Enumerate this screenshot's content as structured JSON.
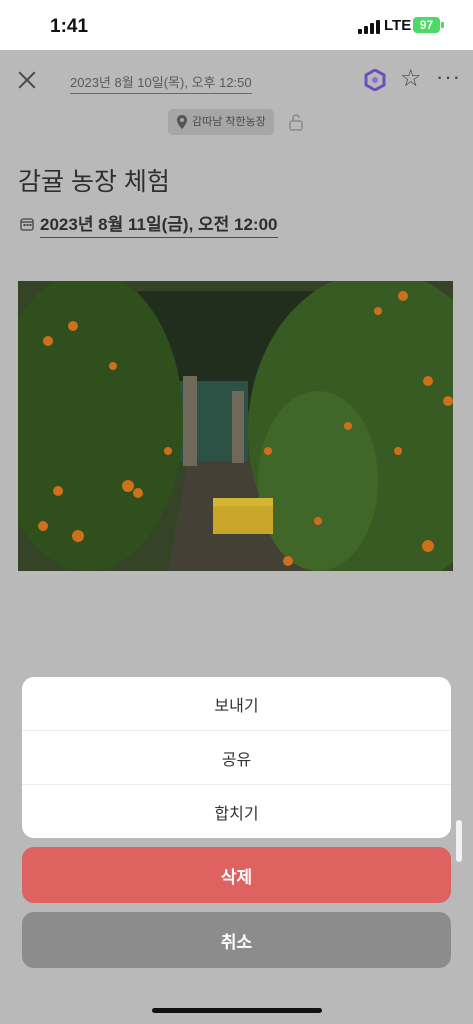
{
  "status_bar": {
    "time": "1:41",
    "network": "LTE",
    "battery": "97"
  },
  "header": {
    "date": "2023년 8월 10일(목), 오후 12:50"
  },
  "location": {
    "label": "감따남 착한농장"
  },
  "note": {
    "title": "감귤 농장 체험",
    "event_date": "2023년 8월 11일(금), 오전 12:00"
  },
  "action_sheet": {
    "items": [
      "보내기",
      "공유",
      "합치기"
    ],
    "delete_label": "삭제",
    "cancel_label": "취소"
  },
  "colors": {
    "delete": "#de6260",
    "cancel": "#8c8c8c",
    "accent": "#6b4fbb"
  },
  "icons": [
    "close-icon",
    "app-logo-icon",
    "star-icon",
    "more-icon",
    "location-pin-icon",
    "lock-icon",
    "calendar-icon"
  ]
}
